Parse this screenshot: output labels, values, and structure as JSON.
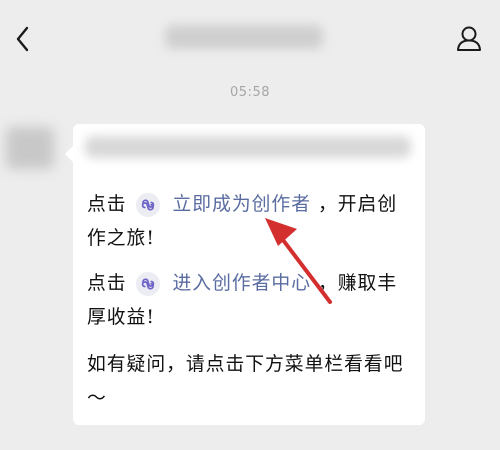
{
  "header": {
    "icons": {
      "back": "chevron-left-icon",
      "profile": "user-icon"
    }
  },
  "timestamp": "05:58",
  "message": {
    "p1_prefix": "点击",
    "p1_link": "立即成为创作者",
    "p1_suffix": "，开启创作之旅!",
    "p2_prefix": "点击",
    "p2_link": "进入创作者中心",
    "p2_suffix": "，赚取丰厚收益!",
    "p3": "如有疑问，请点击下方菜单栏看看吧～",
    "mini_program_icon": "mini-program-icon"
  },
  "colors": {
    "background": "#ededed",
    "bubble": "#ffffff",
    "link": "#5a6ca0",
    "arrow": "#d32f2f",
    "timestamp": "#a6a6a6"
  }
}
